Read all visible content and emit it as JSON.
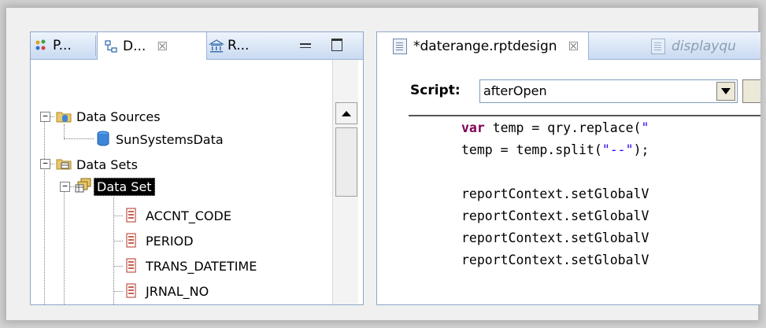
{
  "left_panel": {
    "tabs": [
      {
        "label": "P..."
      },
      {
        "label": "D...",
        "close": "☒"
      },
      {
        "label": "R..."
      }
    ],
    "tree": {
      "data_sources": "Data Sources",
      "source_item": "SunSystemsData",
      "data_sets": "Data Sets",
      "data_set": "Data Set",
      "columns": [
        "ACCNT_CODE",
        "PERIOD",
        "TRANS_DATETIME",
        "JRNAL_NO"
      ]
    }
  },
  "right_panel": {
    "tabs": [
      {
        "label": "*daterange.rptdesign",
        "close": "☒"
      },
      {
        "label": "displayqu"
      }
    ],
    "script_label": "Script:",
    "script_value": "afterOpen",
    "code": [
      {
        "kw": "var",
        "text": " temp = qry.replace(",
        "str": "\""
      },
      {
        "text": "temp = temp.split(",
        "str": "\"--\"",
        "tail": ");"
      },
      {
        "text": ""
      },
      {
        "text": "reportContext.setGlobalV"
      },
      {
        "text": "reportContext.setGlobalV"
      },
      {
        "text": "reportContext.setGlobalV"
      },
      {
        "text": "reportContext.setGlobalV"
      }
    ]
  },
  "colors": {
    "tab_gradient_top": "#eef4fc",
    "tab_gradient_bottom": "#c9daf1",
    "keyword": "#7f0055",
    "string": "#2a00ff",
    "selection_bg": "#000000"
  }
}
